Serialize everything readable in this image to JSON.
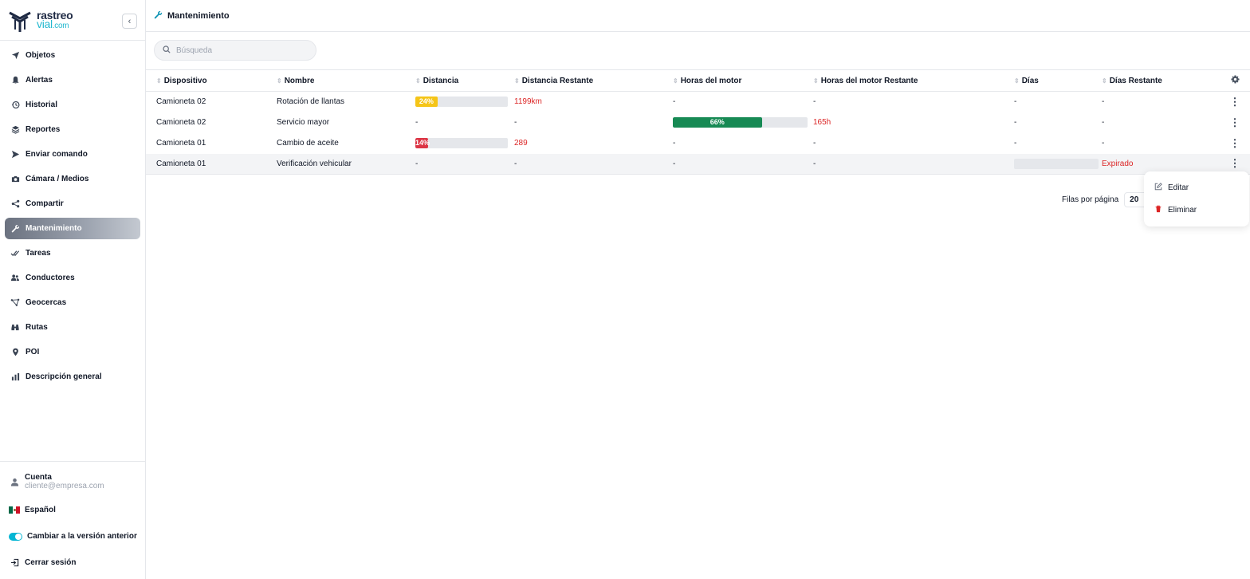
{
  "brand": {
    "line1": "rastreo",
    "line2": "vial",
    "suffix": ".com"
  },
  "sidebar": {
    "items": [
      {
        "label": "Objetos",
        "icon": "navigation-arrow-icon"
      },
      {
        "label": "Alertas",
        "icon": "bell-icon"
      },
      {
        "label": "Historial",
        "icon": "history-icon"
      },
      {
        "label": "Reportes",
        "icon": "layers-icon"
      },
      {
        "label": "Enviar comando",
        "icon": "send-icon"
      },
      {
        "label": "Cámara / Medios",
        "icon": "camera-icon"
      },
      {
        "label": "Compartir",
        "icon": "share-icon"
      },
      {
        "label": "Mantenimiento",
        "icon": "wrench-icon",
        "active": true
      },
      {
        "label": "Tareas",
        "icon": "double-check-icon"
      },
      {
        "label": "Conductores",
        "icon": "users-icon"
      },
      {
        "label": "Geocercas",
        "icon": "polygon-icon"
      },
      {
        "label": "Rutas",
        "icon": "binoculars-icon"
      },
      {
        "label": "POI",
        "icon": "map-pin-icon"
      },
      {
        "label": "Descripción general",
        "icon": "bar-chart-icon"
      }
    ],
    "account": {
      "label": "Cuenta",
      "email": "cliente@empresa.com"
    },
    "language": "Español",
    "legacy_toggle": "Cambiar a la versión anterior",
    "logout": "Cerrar sesión"
  },
  "header": {
    "title": "Mantenimiento"
  },
  "search": {
    "placeholder": "Búsqueda"
  },
  "table": {
    "columns": [
      "Dispositivo",
      "Nombre",
      "Distancia",
      "Distancia Restante",
      "Horas del motor",
      "Horas del motor Restante",
      "Días",
      "Días Restante"
    ],
    "rows": [
      {
        "device": "Camioneta 02",
        "name": "Rotación de llantas",
        "distance_pct": 24,
        "distance_label": "24%",
        "distance_color": "#f5c518",
        "distance_remaining": "1199km",
        "hours": "-",
        "hours_remaining": "-",
        "days": "-",
        "days_remaining": "-"
      },
      {
        "device": "Camioneta 02",
        "name": "Servicio mayor",
        "distance": "-",
        "distance_remaining": "-",
        "hours_pct": 66,
        "hours_label": "66%",
        "hours_color": "#178a54",
        "hours_remaining": "165h",
        "days": "-",
        "days_remaining": "-"
      },
      {
        "device": "Camioneta 01",
        "name": "Cambio de aceite",
        "distance_pct": 14,
        "distance_label": "14%",
        "distance_color": "#dc3545",
        "distance_remaining": "289",
        "hours": "-",
        "hours_remaining": "-",
        "days": "-",
        "days_remaining": "-"
      },
      {
        "device": "Camioneta 01",
        "name": "Verificación vehicular",
        "distance": "-",
        "distance_remaining": "-",
        "hours": "-",
        "hours_remaining": "-",
        "days_pct": 0,
        "days_remaining": "Expirado"
      }
    ]
  },
  "pager": {
    "label": "Filas por página",
    "value": "20"
  },
  "context_menu": {
    "edit": "Editar",
    "delete": "Eliminar"
  },
  "colors": {
    "accent": "#22b8cf",
    "danger": "#dc2626"
  }
}
